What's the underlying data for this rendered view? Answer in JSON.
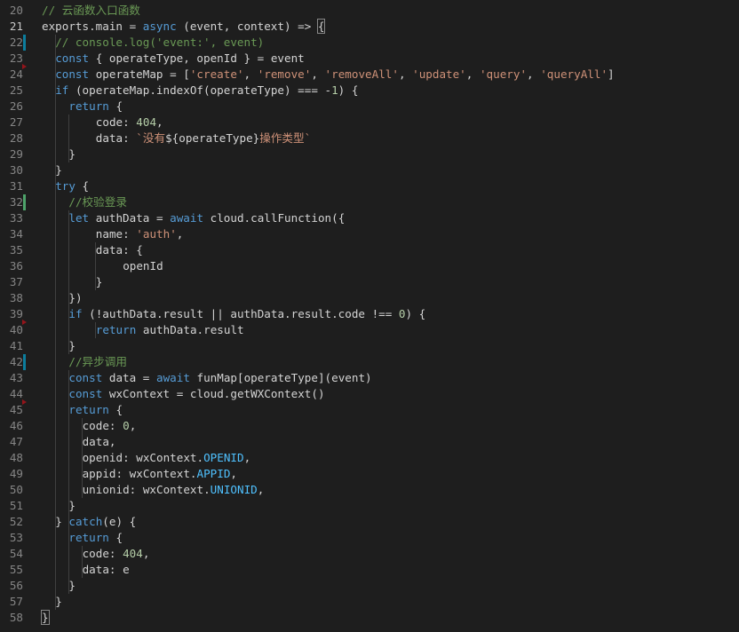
{
  "editor": {
    "line_numbers": [
      "20",
      "21",
      "22",
      "23",
      "24",
      "25",
      "26",
      "27",
      "28",
      "29",
      "30",
      "31",
      "32",
      "33",
      "34",
      "35",
      "36",
      "37",
      "38",
      "39",
      "40",
      "41",
      "42",
      "43",
      "44",
      "45",
      "46",
      "47",
      "48",
      "49",
      "50",
      "51",
      "52",
      "53",
      "54",
      "55",
      "56",
      "57",
      "58"
    ],
    "active_line": "21",
    "colors": {
      "background": "#1e1e1e",
      "keyword": "#569cd6",
      "string": "#ce9178",
      "number": "#b5cea8",
      "comment": "#6a9955",
      "constant": "#4fc1ff",
      "line_number": "#858585",
      "added_marker": "#587c0c",
      "deleted_marker": "#94151b"
    }
  },
  "code": [
    [
      {
        "t": "cm",
        "v": "// 云函数入口函数"
      }
    ],
    [
      {
        "t": "id",
        "v": "exports.main = "
      },
      {
        "t": "kw",
        "v": "async"
      },
      {
        "t": "id",
        "v": " (event, context) => "
      },
      {
        "t": "id",
        "v": "{",
        "box": true
      }
    ],
    [
      {
        "t": "cm",
        "v": "// console.log('event:', event)"
      }
    ],
    [
      {
        "t": "kw",
        "v": "const"
      },
      {
        "t": "id",
        "v": " { operateType, openId } = event"
      }
    ],
    [
      {
        "t": "kw",
        "v": "const"
      },
      {
        "t": "id",
        "v": " operateMap = ["
      },
      {
        "t": "str",
        "v": "'create'"
      },
      {
        "t": "id",
        "v": ", "
      },
      {
        "t": "str",
        "v": "'remove'"
      },
      {
        "t": "id",
        "v": ", "
      },
      {
        "t": "str",
        "v": "'removeAll'"
      },
      {
        "t": "id",
        "v": ", "
      },
      {
        "t": "str",
        "v": "'update'"
      },
      {
        "t": "id",
        "v": ", "
      },
      {
        "t": "str",
        "v": "'query'"
      },
      {
        "t": "id",
        "v": ", "
      },
      {
        "t": "str",
        "v": "'queryAll'"
      },
      {
        "t": "id",
        "v": "]"
      }
    ],
    [
      {
        "t": "kw",
        "v": "if"
      },
      {
        "t": "id",
        "v": " (operateMap.indexOf(operateType) === -"
      },
      {
        "t": "num",
        "v": "1"
      },
      {
        "t": "id",
        "v": ") {"
      }
    ],
    [
      {
        "t": "kw",
        "v": "return"
      },
      {
        "t": "id",
        "v": " {"
      }
    ],
    [
      {
        "t": "id",
        "v": "code: "
      },
      {
        "t": "num",
        "v": "404"
      },
      {
        "t": "id",
        "v": ","
      }
    ],
    [
      {
        "t": "id",
        "v": "data: "
      },
      {
        "t": "str",
        "v": "`没有"
      },
      {
        "t": "id",
        "v": "${operateType}"
      },
      {
        "t": "str",
        "v": "操作类型`"
      }
    ],
    [
      {
        "t": "id",
        "v": "}"
      }
    ],
    [
      {
        "t": "id",
        "v": "}"
      }
    ],
    [
      {
        "t": "kw",
        "v": "try"
      },
      {
        "t": "id",
        "v": " {"
      }
    ],
    [
      {
        "t": "cm",
        "v": "//校验登录"
      }
    ],
    [
      {
        "t": "kw",
        "v": "let"
      },
      {
        "t": "id",
        "v": " authData = "
      },
      {
        "t": "kw",
        "v": "await"
      },
      {
        "t": "id",
        "v": " cloud.callFunction({"
      }
    ],
    [
      {
        "t": "id",
        "v": "name: "
      },
      {
        "t": "str",
        "v": "'auth'"
      },
      {
        "t": "id",
        "v": ","
      }
    ],
    [
      {
        "t": "id",
        "v": "data: {"
      }
    ],
    [
      {
        "t": "id",
        "v": "openId"
      }
    ],
    [
      {
        "t": "id",
        "v": "}"
      }
    ],
    [
      {
        "t": "id",
        "v": "})"
      }
    ],
    [
      {
        "t": "kw",
        "v": "if"
      },
      {
        "t": "id",
        "v": " (!authData.result || authData.result.code !== "
      },
      {
        "t": "num",
        "v": "0"
      },
      {
        "t": "id",
        "v": ") {"
      }
    ],
    [
      {
        "t": "kw",
        "v": "return"
      },
      {
        "t": "id",
        "v": " authData.result"
      }
    ],
    [
      {
        "t": "id",
        "v": "}"
      }
    ],
    [
      {
        "t": "cm",
        "v": "//异步调用"
      }
    ],
    [
      {
        "t": "kw",
        "v": "const"
      },
      {
        "t": "id",
        "v": " data = "
      },
      {
        "t": "kw",
        "v": "await"
      },
      {
        "t": "id",
        "v": " funMap[operateType](event)"
      }
    ],
    [
      {
        "t": "kw",
        "v": "const"
      },
      {
        "t": "id",
        "v": " wxContext = cloud.getWXContext()"
      }
    ],
    [
      {
        "t": "kw",
        "v": "return"
      },
      {
        "t": "id",
        "v": " {"
      }
    ],
    [
      {
        "t": "id",
        "v": "code: "
      },
      {
        "t": "num",
        "v": "0"
      },
      {
        "t": "id",
        "v": ","
      }
    ],
    [
      {
        "t": "id",
        "v": "data,"
      }
    ],
    [
      {
        "t": "id",
        "v": "openid: wxContext."
      },
      {
        "t": "cn",
        "v": "OPENID"
      },
      {
        "t": "id",
        "v": ","
      }
    ],
    [
      {
        "t": "id",
        "v": "appid: wxContext."
      },
      {
        "t": "cn",
        "v": "APPID"
      },
      {
        "t": "id",
        "v": ","
      }
    ],
    [
      {
        "t": "id",
        "v": "unionid: wxContext."
      },
      {
        "t": "cn",
        "v": "UNIONID"
      },
      {
        "t": "id",
        "v": ","
      }
    ],
    [
      {
        "t": "id",
        "v": "}"
      }
    ],
    [
      {
        "t": "id",
        "v": "} "
      },
      {
        "t": "kw",
        "v": "catch"
      },
      {
        "t": "id",
        "v": "(e) {"
      }
    ],
    [
      {
        "t": "kw",
        "v": "return"
      },
      {
        "t": "id",
        "v": " {"
      }
    ],
    [
      {
        "t": "id",
        "v": "code: "
      },
      {
        "t": "num",
        "v": "404"
      },
      {
        "t": "id",
        "v": ","
      }
    ],
    [
      {
        "t": "id",
        "v": "data: e"
      }
    ],
    [
      {
        "t": "id",
        "v": "}"
      }
    ],
    [
      {
        "t": "id",
        "v": "}"
      }
    ],
    [
      {
        "t": "id",
        "v": "}",
        "box": true
      }
    ]
  ]
}
